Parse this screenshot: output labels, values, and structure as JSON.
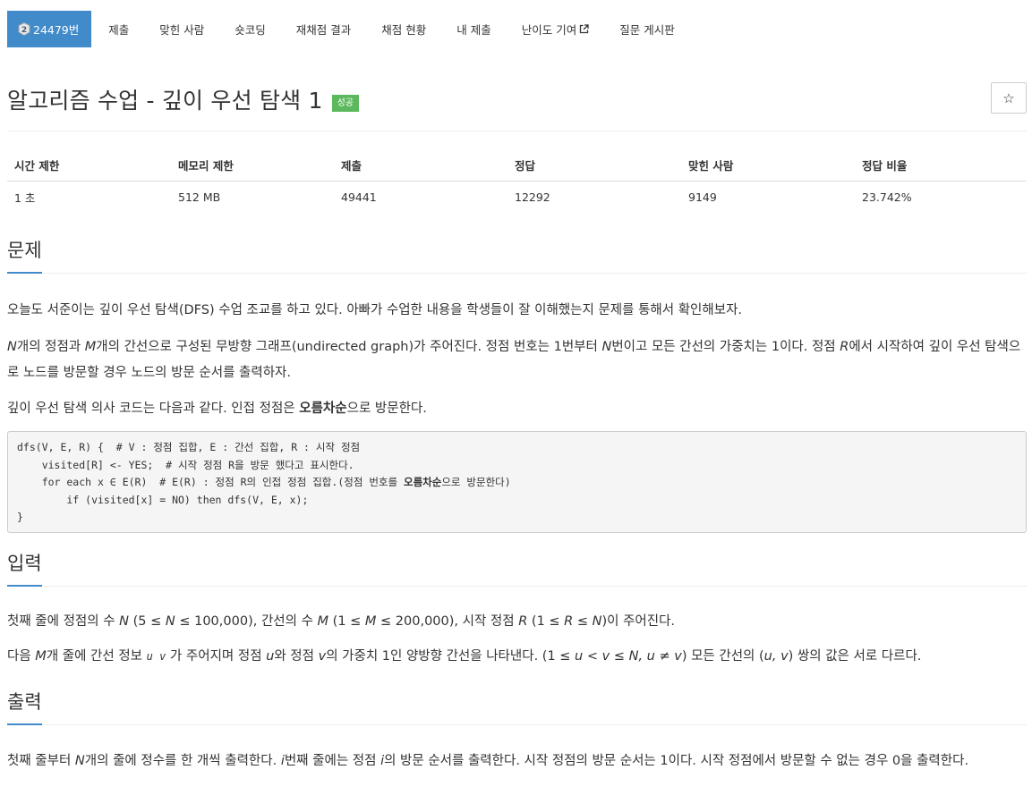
{
  "nav": {
    "problem_number": "24479번",
    "items": [
      "제출",
      "맞힌 사람",
      "숏코딩",
      "재채점 결과",
      "채점 현황",
      "내 제출",
      "난이도 기여",
      "질문 게시판"
    ]
  },
  "title": "알고리즘 수업 - 깊이 우선 탐색 1",
  "status_badge": "성공",
  "star": "☆",
  "info": {
    "headers": [
      "시간 제한",
      "메모리 제한",
      "제출",
      "정답",
      "맞힌 사람",
      "정답 비율"
    ],
    "values": [
      "1 초",
      "512 MB",
      "49441",
      "12292",
      "9149",
      "23.742%"
    ]
  },
  "sections": {
    "problem_title": "문제",
    "input_title": "입력",
    "output_title": "출력"
  },
  "problem": {
    "p1": "오늘도 서준이는 깊이 우선 탐색(DFS) 수업 조교를 하고 있다. 아빠가 수업한 내용을 학생들이 잘 이해했는지 문제를 통해서 확인해보자.",
    "p2_var_n": "N",
    "p2_a": "개의 정점과 ",
    "p2_var_m": "M",
    "p2_b": "개의 간선으로 구성된 무방향 그래프(undirected graph)가 주어진다. 정점 번호는 1번부터 ",
    "p2_var_n2": "N",
    "p2_c": "번이고 모든 간선의 가중치는 1이다. 정점 ",
    "p2_var_r": "R",
    "p2_d": "에서 시작하여 깊이 우선 탐색으로 노드를 방문할 경우 노드의 방문 순서를 출력하자.",
    "p3_a": "깊이 우선 탐색 의사 코드는 다음과 같다. 인접 정점은 ",
    "p3_bold": "오름차순",
    "p3_b": "으로 방문한다."
  },
  "code": {
    "line1": "dfs(V, E, R) {  # V : 정점 집합, E : 간선 집합, R : 시작 정점",
    "line2": "    visited[R] <- YES;  # 시작 정점 R을 방문 했다고 표시한다.",
    "line3_a": "    for each x ∈ E(R)  # E(R) : 정점 R의 인접 정점 집합.(정점 번호를 ",
    "line3_bold": "오름차순",
    "line3_b": "으로 방문한다)",
    "line4": "        if (visited[x] = NO) then dfs(V, E, x);",
    "line5": "}"
  },
  "input": {
    "l1_a": "첫째 줄에 정점의 수 ",
    "l1_n": "N",
    "l1_b": " (5 ≤ ",
    "l1_n2": "N",
    "l1_c": " ≤ 100,000), 간선의 수 ",
    "l1_m": "M",
    "l1_d": " (1 ≤ ",
    "l1_m2": "M",
    "l1_e": " ≤ 200,000), 시작 정점 ",
    "l1_r": "R",
    "l1_f": " (1 ≤ ",
    "l1_r2": "R",
    "l1_g": " ≤ ",
    "l1_n3": "N",
    "l1_h": ")이 주어진다.",
    "l2_a": "다음 ",
    "l2_m": "M",
    "l2_b": "개 줄에 간선 정보 ",
    "l2_code": "u v",
    "l2_c": " 가 주어지며 정점 ",
    "l2_u": "u",
    "l2_d": "와 정점 ",
    "l2_v": "v",
    "l2_e": "의 가중치 1인 양방향 간선을 나타낸다. (1 ≤ ",
    "l2_u2": "u",
    "l2_f": " < ",
    "l2_v2": "v",
    "l2_g": " ≤ ",
    "l2_n": "N, u ≠ v",
    "l2_h": ") 모든 간선의 (",
    "l2_uv": "u, v",
    "l2_i": ") 쌍의 값은 서로 다르다."
  },
  "output": {
    "a": "첫째 줄부터 ",
    "n": "N",
    "b": "개의 줄에 정수를 한 개씩 출력한다. ",
    "i": "i",
    "c": "번째 줄에는 정점 ",
    "i2": "i",
    "d": "의 방문 순서를 출력한다. 시작 정점의 방문 순서는 1이다. 시작 정점에서 방문할 수 없는 경우 0을 출력한다."
  }
}
